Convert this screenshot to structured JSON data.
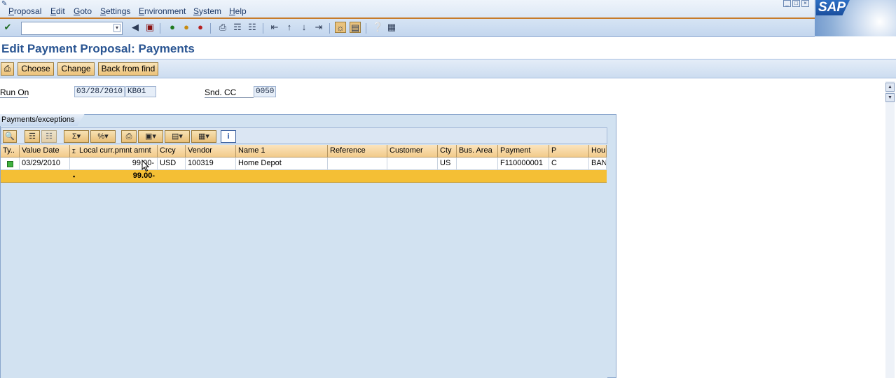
{
  "menubar": {
    "items": [
      "Proposal",
      "Edit",
      "Goto",
      "Settings",
      "Environment",
      "System",
      "Help"
    ],
    "logo_text": "SAP"
  },
  "toolbar": {
    "command_field_value": "",
    "icons": [
      "enter-icon",
      "back-icon",
      "save-icon",
      "back-green-icon",
      "exit-icon",
      "cancel-icon",
      "print-icon",
      "find-icon",
      "find-next-icon",
      "first-page-icon",
      "prev-page-icon",
      "next-page-icon",
      "last-page-icon",
      "create-session-icon",
      "shortcut-icon",
      "help-icon",
      "layout-icon"
    ]
  },
  "page": {
    "title": "Edit Payment Proposal: Payments"
  },
  "app_toolbar": {
    "choose": "Choose",
    "change": "Change",
    "back_from_find": "Back from find"
  },
  "header": {
    "run_on_label": "Run On",
    "run_on_date": "03/28/2010",
    "run_on_id": "KB01",
    "snd_cc_label": "Snd. CC",
    "snd_cc_value": "0050"
  },
  "panel": {
    "tab_label": "Payments/exceptions"
  },
  "grid": {
    "columns": [
      "Ty..",
      "Value Date",
      "Local curr.pmnt amnt",
      "Crcy",
      "Vendor",
      "Name 1",
      "Reference",
      "Customer",
      "Cty",
      "Bus. Area",
      "Payment",
      "P",
      "Hou"
    ],
    "rows": [
      {
        "value_date": "03/29/2010",
        "amount": "99.00-",
        "crcy": "USD",
        "vendor": "100319",
        "name1": "Home Depot",
        "reference": "",
        "customer": "",
        "cty": "US",
        "bus_area": "",
        "payment": "F110000001",
        "p": "C",
        "hou": "BAN"
      }
    ],
    "total": {
      "marker": "▪",
      "amount": "99.00-"
    }
  },
  "colors": {
    "title": "#2a5592",
    "total_row": "#f4bf35",
    "header_cells": "#f2cb8a",
    "status_green": "#3fb23f"
  }
}
